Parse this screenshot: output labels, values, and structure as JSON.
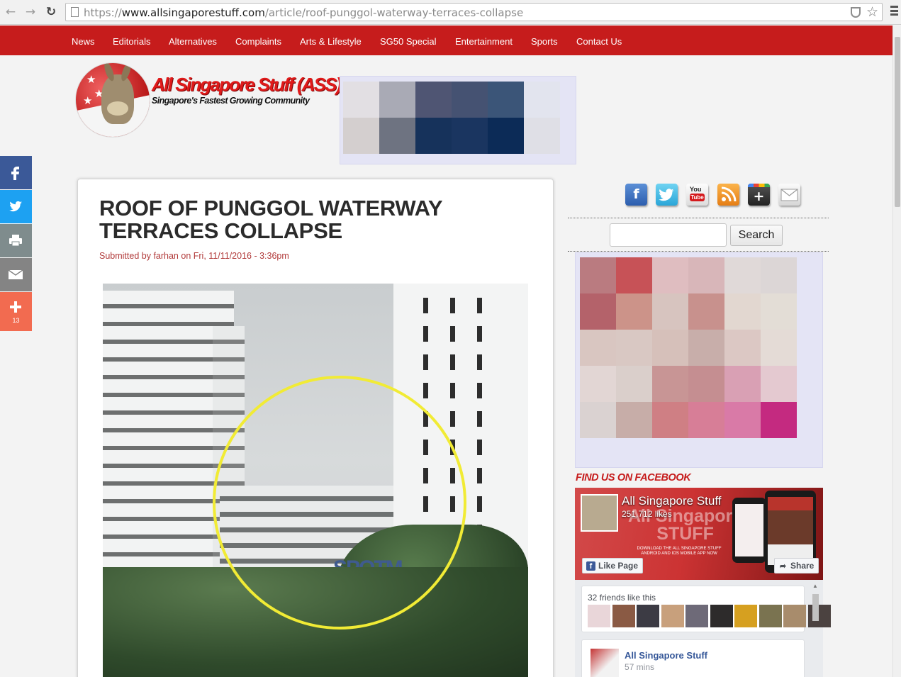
{
  "browser": {
    "url_scheme": "https://",
    "url_host": "www.allsingaporestuff.com",
    "url_path": "/article/roof-punggol-waterway-terraces-collapse"
  },
  "nav": {
    "items": [
      "News",
      "Editorials",
      "Alternatives",
      "Complaints",
      "Arts & Lifestyle",
      "SG50 Special",
      "Entertainment",
      "Sports",
      "Contact Us"
    ],
    "bg_color": "#c61c1c"
  },
  "logo": {
    "title": "All Singapore Stuff (ASS)",
    "tagline": "Singapore's Fastest Growing Community"
  },
  "share_bar": {
    "facebook_color": "#3b5998",
    "twitter_color": "#1da1f2",
    "print_color": "#7f8c8d",
    "email_color": "#848484",
    "more_color": "#f26b50",
    "more_count": "13"
  },
  "article": {
    "title": "ROOF OF PUNGGOL WATERWAY TERRACES COLLAPSE",
    "meta_prefix": "Submitted by ",
    "author": "farhan",
    "meta_on": " on ",
    "date": "Fri, 11/11/2016 - 3:36pm",
    "photo_sign": "SPOTM"
  },
  "sidebar": {
    "social_icons": [
      "facebook-icon",
      "twitter-icon",
      "youtube-icon",
      "rss-icon",
      "google-plus-icon",
      "email-icon"
    ],
    "youtube_top": "You",
    "youtube_bottom": "Tube",
    "search_button": "Search",
    "search_value": "",
    "fb_heading": "FIND US ON FACEBOOK",
    "fb_page_name": "All Singapore Stuff",
    "fb_likes": "251,712 likes",
    "fb_cover_ghost_1": "All Singapore",
    "fb_cover_ghost_2": "STUFF",
    "fb_cover_small": "DOWNLOAD THE ALL SINGAPORE STUFF ANDROID AND IOS MOBILE APP NOW",
    "fb_like_button": "Like Page",
    "fb_share_button": "Share",
    "friends_text": "32 friends like this",
    "post_name": "All Singapore Stuff",
    "post_time": "57 mins"
  }
}
